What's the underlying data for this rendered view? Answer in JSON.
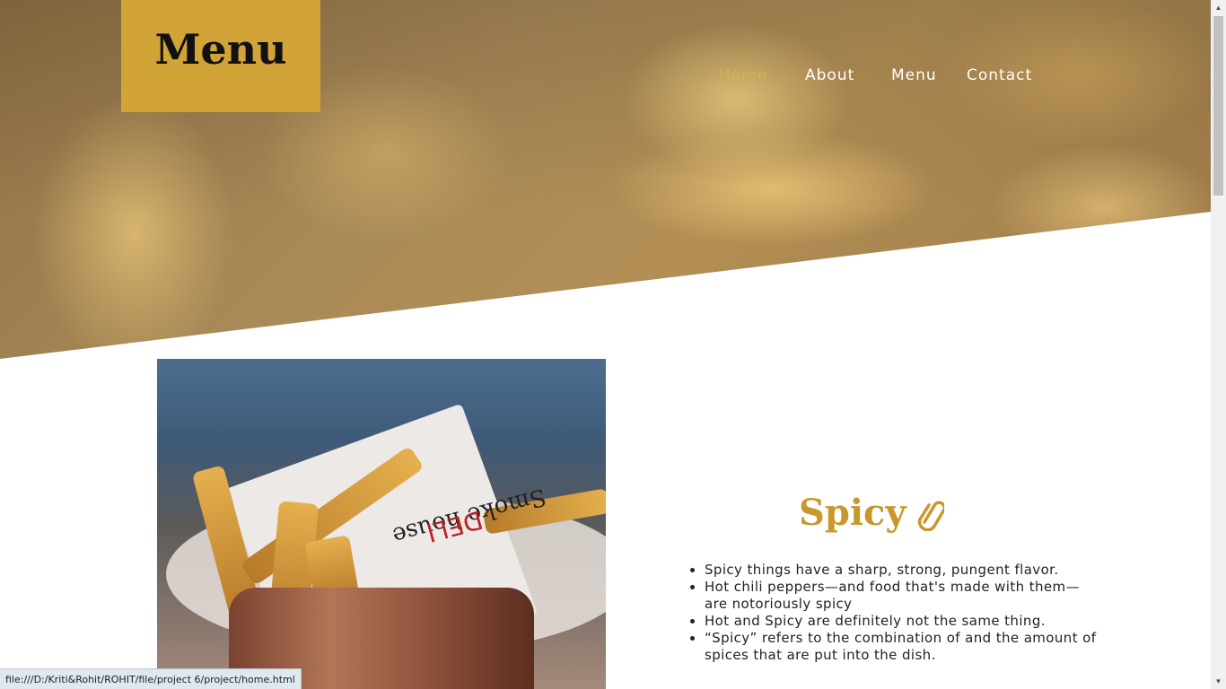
{
  "header": {
    "logo_text": "Menu",
    "nav": [
      {
        "label": "Home",
        "active": true
      },
      {
        "label": "About",
        "active": false
      },
      {
        "label": "Menu",
        "active": false
      },
      {
        "label": "Contact",
        "active": false
      }
    ]
  },
  "hero": {
    "image": "fries-closeup"
  },
  "section": {
    "image": "fries-in-copper-cup",
    "paper_text": "Smoke house",
    "paper_brand": "DELI",
    "title": "Spicy",
    "title_icon": "link-icon",
    "bullets": [
      "Spicy things have a sharp, strong, pungent flavor.",
      "Hot chili peppers—and food that's made with them—are notoriously spicy",
      "Hot and Spicy are definitely not the same thing.",
      "“Spicy” refers to the combination of and the amount of spices that are put into the dish."
    ]
  },
  "status_bar": {
    "url": "file:///D:/Kriti&Rohit/ROHIT/file/project 6/project/home.html"
  },
  "colors": {
    "accent": "#d2a437",
    "title": "#c9982c",
    "nav_active": "#d7b04f"
  }
}
